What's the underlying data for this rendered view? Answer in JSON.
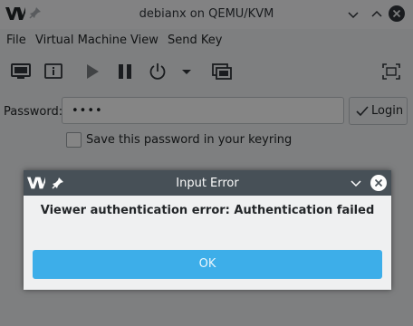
{
  "window": {
    "title": "debianx on QEMU/KVM",
    "logo_icon": "virt-manager-logo-icon",
    "pin_icon": "pin-icon",
    "min_icon": "chevron-down-icon",
    "max_icon": "chevron-up-icon",
    "close_icon": "close-icon"
  },
  "menubar": {
    "items": [
      "File",
      "Virtual Machine",
      "View",
      "Send Key"
    ]
  },
  "toolbar": {
    "icons": [
      "console-icon",
      "details-icon",
      "run-icon",
      "pause-icon",
      "shutdown-icon",
      "dropdown-arrow-icon",
      "snapshots-icon",
      "fullscreen-icon"
    ]
  },
  "auth": {
    "password_label": "Password:",
    "password_value": "••••",
    "login_label": "Login",
    "save_password_label": "Save this password in your keyring",
    "save_password_checked": false
  },
  "dialog": {
    "title": "Input Error",
    "message": "Viewer authentication error: Authentication failed",
    "ok_label": "OK",
    "accent_color": "#3daee9",
    "titlebar_color": "#475057"
  }
}
